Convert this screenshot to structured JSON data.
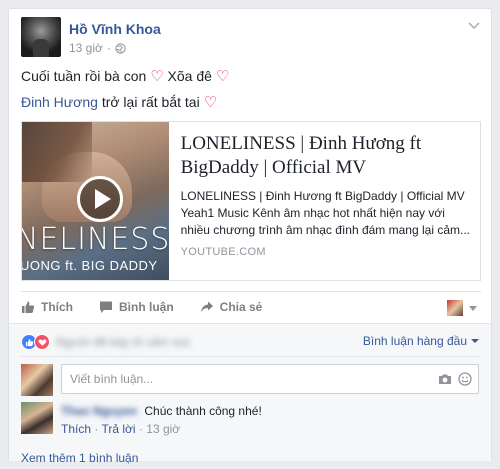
{
  "post": {
    "author": "Hồ Vĩnh Khoa",
    "time": "13 giờ",
    "line1_text": "Cuối tuần rồi bà con",
    "line1_text2": "Xõa đê",
    "mention": "Đinh Hương",
    "line2_text": "trở lại rất bắt tai",
    "heart": "♡"
  },
  "link_preview": {
    "thumb_title": "NELINESS",
    "thumb_sub": "UONG ft. BIG DADDY",
    "title": "LONELINESS | Đinh Hương ft BigDaddy | Official MV",
    "desc_line1": "LONELINESS | Đinh Hương ft BigDaddy | Official MV",
    "desc_line2": "Yeah1 Music Kênh âm nhạc hot nhất hiện nay với",
    "desc_line3": "nhiều chương trình âm nhạc đình đám mang lại cảm...",
    "domain": "YOUTUBE.COM"
  },
  "actions": {
    "like": "Thích",
    "comment": "Bình luận",
    "share": "Chia sẻ"
  },
  "comments": {
    "reaction_names": "Người đã bày tỏ cảm xúc",
    "top_comments_label": "Bình luận hàng đầu",
    "input_placeholder": "Viết bình luận...",
    "items": [
      {
        "name": "Thao Nguyen",
        "text": "Chúc thành công nhé!",
        "like": "Thích",
        "reply": "Trả lời",
        "time": "13 giờ"
      }
    ],
    "more_label": "Xem thêm 1 bình luận"
  },
  "colors": {
    "link": "#365899",
    "love": "#f25268",
    "like": "#4080ff"
  }
}
